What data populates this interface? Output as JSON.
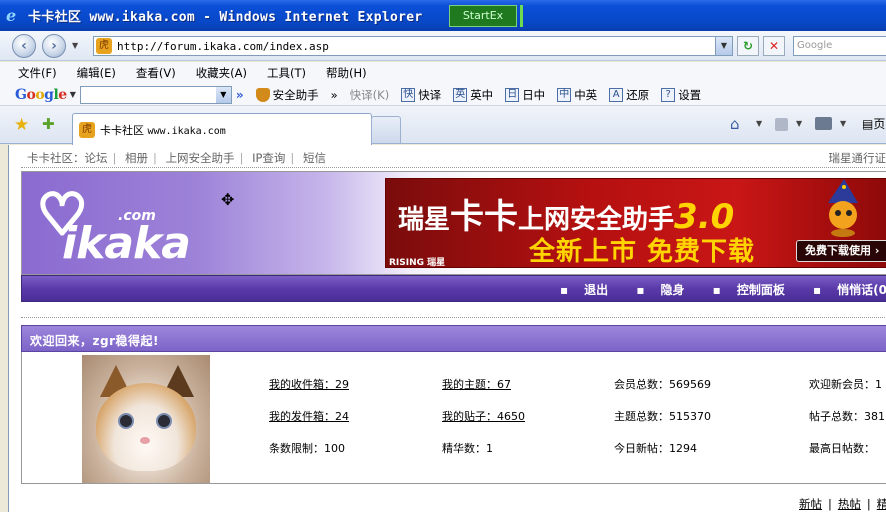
{
  "window": {
    "title": "卡卡社区 www.ikaka.com - Windows Internet Explorer",
    "startex_label": "StartEx"
  },
  "address_bar": {
    "url": "http://forum.ikaka.com/index.asp",
    "search_placeholder": "Google",
    "back_icon": "back-arrow-icon",
    "forward_icon": "forward-arrow-icon"
  },
  "menu": {
    "items": [
      "文件(F)",
      "编辑(E)",
      "查看(V)",
      "收藏夹(A)",
      "工具(T)",
      "帮助(H)"
    ]
  },
  "google_toolbar": {
    "logo": [
      "G",
      "o",
      "o",
      "g",
      "l",
      "e"
    ],
    "chevron": "»",
    "security": "安全助手",
    "chevron2": "»",
    "kuaiyi_grey": "快译(K)",
    "tools": [
      {
        "icon": "快",
        "label": "快译"
      },
      {
        "icon": "英",
        "label": "英中"
      },
      {
        "icon": "日",
        "label": "日中"
      },
      {
        "icon": "中",
        "label": "中英"
      },
      {
        "icon": "A",
        "label": "还原"
      },
      {
        "icon": "?",
        "label": "设置"
      }
    ]
  },
  "tab": {
    "title_cn": "卡卡社区",
    "title_url": "www.ikaka.com",
    "page_menu": "页"
  },
  "site_nav": {
    "items": [
      "卡卡社区：论坛",
      "相册",
      "上网安全助手",
      "IP查询",
      "短信"
    ],
    "right": "瑞星通行证"
  },
  "banner": {
    "logo_word": "ikaka",
    "logo_com": ".com",
    "ad_brand_a": "瑞星",
    "ad_brand_b": "卡卡",
    "ad_brand_c": "上网安全助手",
    "ad_version": "3.0",
    "ad_slogan": "全新上市 免费下载",
    "ad_rising": "RISING 瑞星",
    "ad_download": "免费下载使用 ›"
  },
  "navbar": {
    "items": [
      "退出",
      "隐身",
      "控制面板",
      "悄悄话(0"
    ]
  },
  "welcome": {
    "text": "欢迎回来，zgr稳得起!"
  },
  "stats": {
    "inbox": "我的收件箱：29",
    "outbox": "我的发件箱：24",
    "limit": "条数限制：100",
    "my_topics": "我的主题：67",
    "my_posts": "我的贴子：4650",
    "essence": "精华数：1",
    "members": "会员总数：569569",
    "topics": "主题总数：515370",
    "today": "今日新帖：1294",
    "new_member": "欢迎新会员：1",
    "posts": "帖子总数：381",
    "max_day": "最高日帖数："
  },
  "footer_links": [
    "新帖",
    "热帖",
    "精"
  ]
}
